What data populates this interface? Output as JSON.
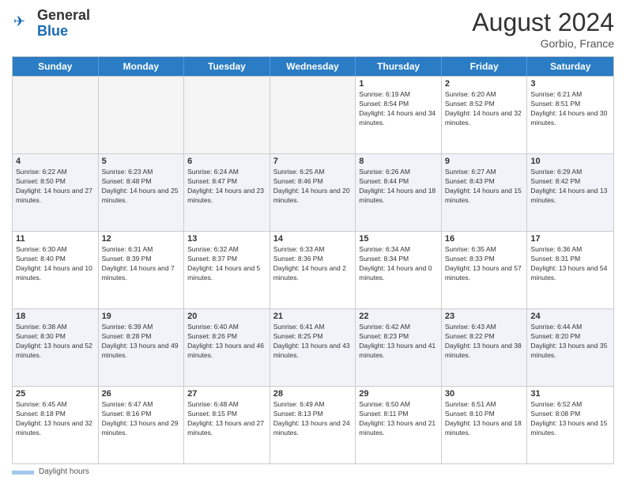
{
  "header": {
    "logo_general": "General",
    "logo_blue": "Blue",
    "month_year": "August 2024",
    "location": "Gorbio, France"
  },
  "calendar": {
    "days_of_week": [
      "Sunday",
      "Monday",
      "Tuesday",
      "Wednesday",
      "Thursday",
      "Friday",
      "Saturday"
    ],
    "weeks": [
      [
        {
          "day": "",
          "empty": true
        },
        {
          "day": "",
          "empty": true
        },
        {
          "day": "",
          "empty": true
        },
        {
          "day": "",
          "empty": true
        },
        {
          "day": "1",
          "sunrise": "6:19 AM",
          "sunset": "8:54 PM",
          "daylight": "14 hours and 34 minutes."
        },
        {
          "day": "2",
          "sunrise": "6:20 AM",
          "sunset": "8:52 PM",
          "daylight": "14 hours and 32 minutes."
        },
        {
          "day": "3",
          "sunrise": "6:21 AM",
          "sunset": "8:51 PM",
          "daylight": "14 hours and 30 minutes."
        }
      ],
      [
        {
          "day": "4",
          "sunrise": "6:22 AM",
          "sunset": "8:50 PM",
          "daylight": "14 hours and 27 minutes."
        },
        {
          "day": "5",
          "sunrise": "6:23 AM",
          "sunset": "8:48 PM",
          "daylight": "14 hours and 25 minutes."
        },
        {
          "day": "6",
          "sunrise": "6:24 AM",
          "sunset": "8:47 PM",
          "daylight": "14 hours and 23 minutes."
        },
        {
          "day": "7",
          "sunrise": "6:25 AM",
          "sunset": "8:46 PM",
          "daylight": "14 hours and 20 minutes."
        },
        {
          "day": "8",
          "sunrise": "6:26 AM",
          "sunset": "8:44 PM",
          "daylight": "14 hours and 18 minutes."
        },
        {
          "day": "9",
          "sunrise": "6:27 AM",
          "sunset": "8:43 PM",
          "daylight": "14 hours and 15 minutes."
        },
        {
          "day": "10",
          "sunrise": "6:29 AM",
          "sunset": "8:42 PM",
          "daylight": "14 hours and 13 minutes."
        }
      ],
      [
        {
          "day": "11",
          "sunrise": "6:30 AM",
          "sunset": "8:40 PM",
          "daylight": "14 hours and 10 minutes."
        },
        {
          "day": "12",
          "sunrise": "6:31 AM",
          "sunset": "8:39 PM",
          "daylight": "14 hours and 7 minutes."
        },
        {
          "day": "13",
          "sunrise": "6:32 AM",
          "sunset": "8:37 PM",
          "daylight": "14 hours and 5 minutes."
        },
        {
          "day": "14",
          "sunrise": "6:33 AM",
          "sunset": "8:36 PM",
          "daylight": "14 hours and 2 minutes."
        },
        {
          "day": "15",
          "sunrise": "6:34 AM",
          "sunset": "8:34 PM",
          "daylight": "14 hours and 0 minutes."
        },
        {
          "day": "16",
          "sunrise": "6:35 AM",
          "sunset": "8:33 PM",
          "daylight": "13 hours and 57 minutes."
        },
        {
          "day": "17",
          "sunrise": "6:36 AM",
          "sunset": "8:31 PM",
          "daylight": "13 hours and 54 minutes."
        }
      ],
      [
        {
          "day": "18",
          "sunrise": "6:38 AM",
          "sunset": "8:30 PM",
          "daylight": "13 hours and 52 minutes."
        },
        {
          "day": "19",
          "sunrise": "6:39 AM",
          "sunset": "8:28 PM",
          "daylight": "13 hours and 49 minutes."
        },
        {
          "day": "20",
          "sunrise": "6:40 AM",
          "sunset": "8:26 PM",
          "daylight": "13 hours and 46 minutes."
        },
        {
          "day": "21",
          "sunrise": "6:41 AM",
          "sunset": "8:25 PM",
          "daylight": "13 hours and 43 minutes."
        },
        {
          "day": "22",
          "sunrise": "6:42 AM",
          "sunset": "8:23 PM",
          "daylight": "13 hours and 41 minutes."
        },
        {
          "day": "23",
          "sunrise": "6:43 AM",
          "sunset": "8:22 PM",
          "daylight": "13 hours and 38 minutes."
        },
        {
          "day": "24",
          "sunrise": "6:44 AM",
          "sunset": "8:20 PM",
          "daylight": "13 hours and 35 minutes."
        }
      ],
      [
        {
          "day": "25",
          "sunrise": "6:45 AM",
          "sunset": "8:18 PM",
          "daylight": "13 hours and 32 minutes."
        },
        {
          "day": "26",
          "sunrise": "6:47 AM",
          "sunset": "8:16 PM",
          "daylight": "13 hours and 29 minutes."
        },
        {
          "day": "27",
          "sunrise": "6:48 AM",
          "sunset": "8:15 PM",
          "daylight": "13 hours and 27 minutes."
        },
        {
          "day": "28",
          "sunrise": "6:49 AM",
          "sunset": "8:13 PM",
          "daylight": "13 hours and 24 minutes."
        },
        {
          "day": "29",
          "sunrise": "6:50 AM",
          "sunset": "8:11 PM",
          "daylight": "13 hours and 21 minutes."
        },
        {
          "day": "30",
          "sunrise": "6:51 AM",
          "sunset": "8:10 PM",
          "daylight": "13 hours and 18 minutes."
        },
        {
          "day": "31",
          "sunrise": "6:52 AM",
          "sunset": "8:08 PM",
          "daylight": "13 hours and 15 minutes."
        }
      ]
    ]
  },
  "legend": {
    "daylight_label": "Daylight hours"
  }
}
